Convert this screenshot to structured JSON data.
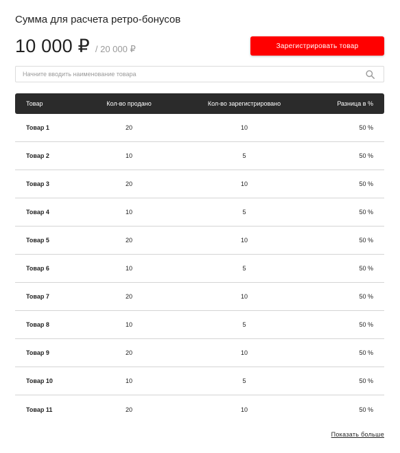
{
  "header": {
    "title": "Сумма для расчета ретро-бонусов",
    "amount": "10 000 ₽",
    "amount_total": "/ 20 000 ₽",
    "register_button": "Зарегистрировать товар"
  },
  "search": {
    "placeholder": "Начните вводить наименование товара",
    "value": ""
  },
  "table": {
    "columns": [
      "Товар",
      "Кол-во продано",
      "Кол-во зарегистрировано",
      "Разница в %"
    ],
    "rows": [
      [
        "Товар 1",
        "20",
        "10",
        "50 %"
      ],
      [
        "Товар 2",
        "10",
        "5",
        "50 %"
      ],
      [
        "Товар 3",
        "20",
        "10",
        "50 %"
      ],
      [
        "Товар 4",
        "10",
        "5",
        "50 %"
      ],
      [
        "Товар 5",
        "20",
        "10",
        "50 %"
      ],
      [
        "Товар 6",
        "10",
        "5",
        "50 %"
      ],
      [
        "Товар 7",
        "20",
        "10",
        "50 %"
      ],
      [
        "Товар 8",
        "10",
        "5",
        "50 %"
      ],
      [
        "Товар 9",
        "20",
        "10",
        "50 %"
      ],
      [
        "Товар 10",
        "10",
        "5",
        "50 %"
      ],
      [
        "Товар 11",
        "20",
        "10",
        "50 %"
      ]
    ]
  },
  "footer": {
    "show_more": "Показать больше"
  },
  "icons": {
    "search": "search-icon"
  },
  "colors": {
    "accent": "#ff0000",
    "table_header": "#2b2b2b"
  }
}
